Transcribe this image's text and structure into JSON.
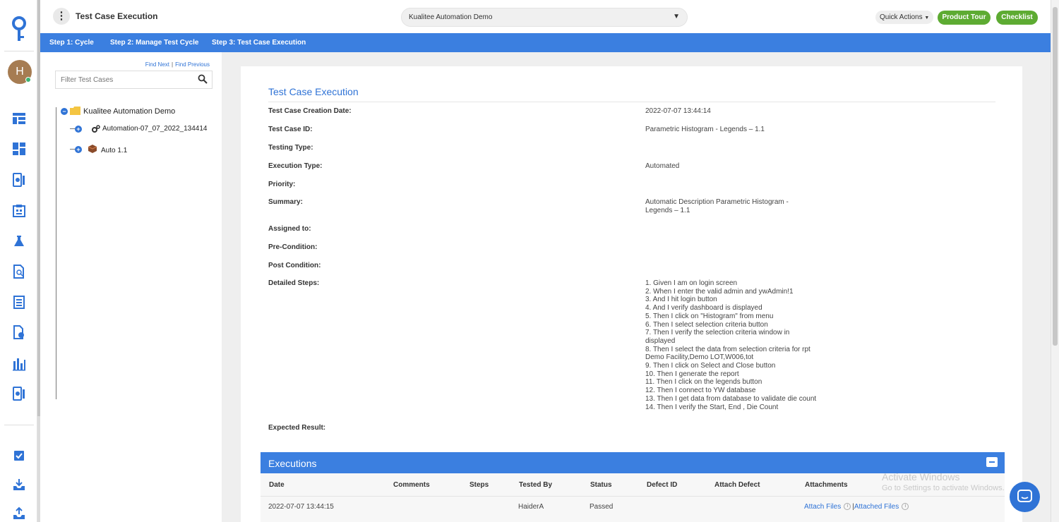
{
  "header": {
    "page_title": "Test Case Execution",
    "project": "Kualitee Automation Demo",
    "quick_actions": "Quick Actions",
    "product_tour": "Product Tour",
    "checklist": "Checklist"
  },
  "user": {
    "initial": "H"
  },
  "steps": [
    "Step 1: Cycle",
    "Step 2: Manage Test Cycle",
    "Step 3: Test Case Execution"
  ],
  "tree": {
    "find_next": "Find Next",
    "find_previous": "Find Previous",
    "filter_placeholder": "Filter Test Cases",
    "root": "Kualitee Automation Demo",
    "children": [
      "Automation-07_07_2022_134414",
      "Auto 1.1"
    ]
  },
  "details": {
    "title": "Test Case Execution",
    "fields": [
      {
        "label": "Test Case Creation Date:",
        "value": "2022-07-07 13:44:14"
      },
      {
        "label": "Test Case ID:",
        "value": "Parametric Histogram - Legends – 1.1"
      },
      {
        "label": "Testing Type:",
        "value": ""
      },
      {
        "label": "Execution Type:",
        "value": "Automated"
      },
      {
        "label": "Priority:",
        "value": ""
      },
      {
        "label": "Summary:",
        "value": "Automatic Description Parametric Histogram - Legends – 1.1"
      },
      {
        "label": "Assigned to:",
        "value": ""
      },
      {
        "label": "Pre-Condition:",
        "value": ""
      },
      {
        "label": "Post Condition:",
        "value": ""
      },
      {
        "label": "Detailed Steps:",
        "value": ""
      },
      {
        "label": "Expected Result:",
        "value": ""
      }
    ],
    "detailed_steps": [
      "1. Given I am on login screen",
      "2. When I enter the valid admin and ywAdmin!1",
      "3. And I hit login button",
      "4. And I verify dashboard is displayed",
      "5. Then I click on \"Histogram\" from menu",
      "6. Then I select selection criteria button",
      "7. Then I verify the selection criteria window in displayed",
      "8. Then I select the data from selection criteria for rpt Demo Facility,Demo LOT,W006,tot",
      "9. Then I click on Select and Close button",
      "10. Then I generate the report",
      "11. Then I click on the legends button",
      "12. Then I connect to YW database",
      "13. Then I get data from database to validate die count",
      "14. Then I verify the Start, End , Die Count"
    ]
  },
  "executions": {
    "title": "Executions",
    "columns": [
      "Date",
      "Comments",
      "Steps",
      "Tested By",
      "Status",
      "Defect ID",
      "Attach Defect",
      "Attachments"
    ],
    "rows": [
      {
        "date": "2022-07-07 13:44:15",
        "comments": "",
        "steps": "",
        "tested_by": "HaiderA",
        "status": "Passed",
        "defect_id": "",
        "attach_defect": "",
        "attach_files": "Attach Files",
        "attached_files": "Attached Files"
      }
    ]
  },
  "watermark": {
    "line1": "Activate Windows",
    "line2": "Go to Settings to activate Windows."
  },
  "colors": {
    "primary": "#3b7fe0",
    "green": "#5dab32",
    "link": "#2f73d6"
  }
}
